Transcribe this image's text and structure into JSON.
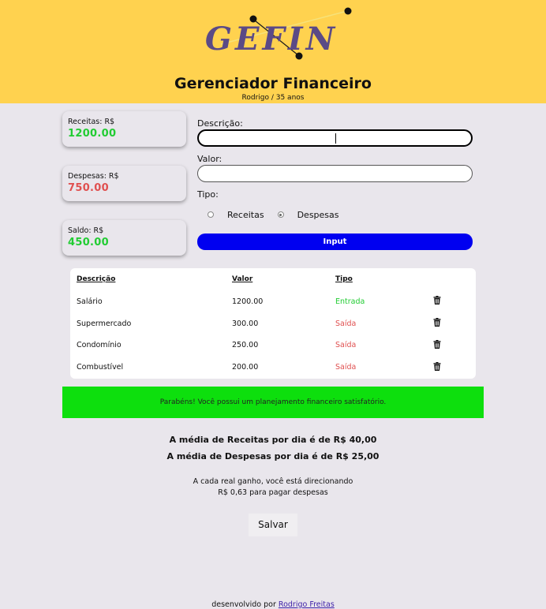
{
  "header": {
    "logo_text": "GEFIN",
    "title": "Gerenciador Financeiro",
    "subtitle": "Rodrigo / 35 anos"
  },
  "summary": {
    "income_label": "Receitas: R$",
    "income_value": "1200.00",
    "expense_label": "Despesas: R$",
    "expense_value": "750.00",
    "balance_label": "Saldo: R$",
    "balance_value": "450.00"
  },
  "form": {
    "description_label": "Descrição:",
    "description_value": "",
    "value_label": "Valor:",
    "value_value": "",
    "type_label": "Tipo:",
    "type_options": [
      "Receitas",
      "Despesas"
    ],
    "type_selected": "Despesas",
    "submit_label": "Input"
  },
  "table": {
    "headers": [
      "Descrição",
      "Valor",
      "Tipo"
    ],
    "rows": [
      {
        "description": "Salário",
        "value": "1200.00",
        "type": "Entrada"
      },
      {
        "description": "Supermercado",
        "value": "300.00",
        "type": "Saída"
      },
      {
        "description": "Condomínio",
        "value": "250.00",
        "type": "Saída"
      },
      {
        "description": "Combustível",
        "value": "200.00",
        "type": "Saída"
      }
    ]
  },
  "banner": {
    "message": "Parabéns! Você possui um planejamento financeiro satisfatório.",
    "color": "#0ddf0d"
  },
  "stats": {
    "avg_income": "A média de Receitas por dia é de R$ 40,00",
    "avg_expense": "A média de Despesas por dia é de R$ 25,00",
    "ratio_line1": "A cada real ganho, você está direcionando",
    "ratio_line2": "R$ 0,63 para pagar despesas"
  },
  "actions": {
    "save_label": "Salvar"
  },
  "footer": {
    "prefix": "desenvolvido por",
    "author": "Rodrigo Freitas"
  },
  "colors": {
    "header_bg": "#ffd24f",
    "income": "#22cc33",
    "expense": "#e05050",
    "button": "#0000f0"
  },
  "icons": {
    "delete": "trash-icon"
  }
}
